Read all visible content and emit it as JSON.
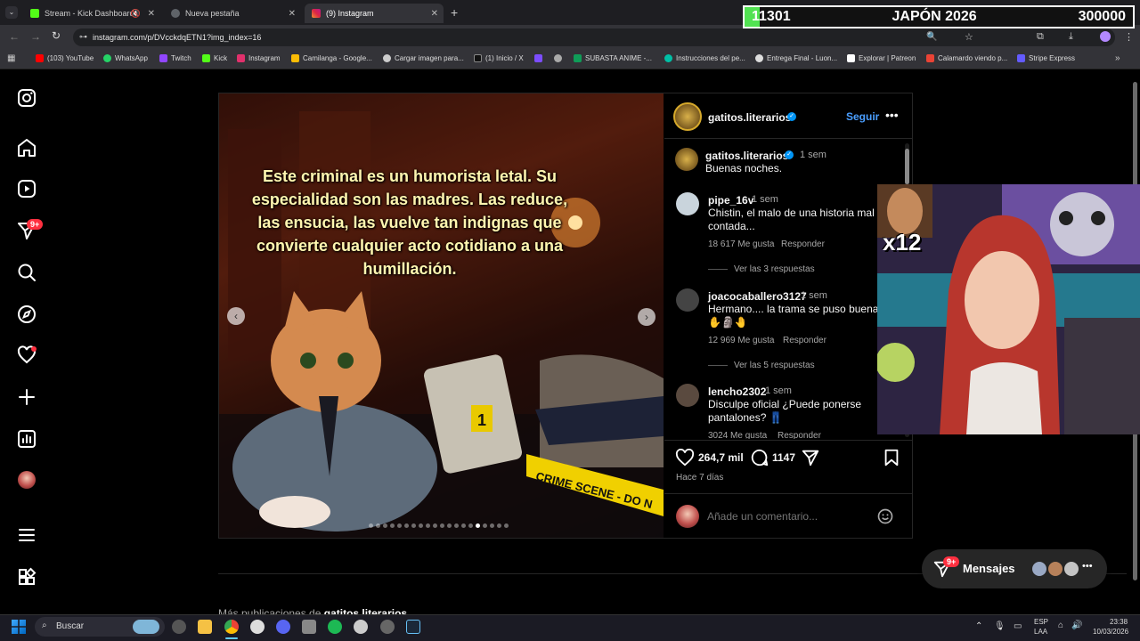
{
  "browser": {
    "tabs": [
      {
        "label": "Stream - Kick Dashboard",
        "color": "#53fc18"
      },
      {
        "label": "Nueva pestaña",
        "color": "#5f6368"
      },
      {
        "label": "(9) Instagram",
        "color": "#e1306c"
      }
    ],
    "url": "instagram.com/p/DVcckdqETN1?img_index=16",
    "bookmarks": [
      {
        "label": "(103) YouTube",
        "color": "#ff0000"
      },
      {
        "label": "WhatsApp",
        "color": "#25d366"
      },
      {
        "label": "Twitch",
        "color": "#9146ff"
      },
      {
        "label": "Kick",
        "color": "#53fc18"
      },
      {
        "label": "Instagram",
        "color": "#e1306c"
      },
      {
        "label": "Camilanga - Google...",
        "color": "#fbbc05"
      },
      {
        "label": "Cargar imagen para...",
        "color": "#cccccc"
      },
      {
        "label": "(1) Inicio / X",
        "color": "#111111"
      },
      {
        "label": "SUBASTA ANIME -...",
        "color": "#0f9d58"
      },
      {
        "label": "Instrucciones del pe...",
        "color": "#00bfa5"
      },
      {
        "label": "Entrega Final - Luon...",
        "color": "#dddddd"
      },
      {
        "label": "Explorar | Patreon",
        "color": "#ffffff"
      },
      {
        "label": "Calamardo viendo p...",
        "color": "#ea4335"
      },
      {
        "label": "Stripe Express",
        "color": "#635bff"
      }
    ]
  },
  "stream_goal": {
    "current": "11301",
    "title": "JAPÓN 2026",
    "target": "300000",
    "progress_fraction": 0.038
  },
  "sidebar": {
    "notification_badge": "9+"
  },
  "post": {
    "caption_text": "Este criminal es un humorista letal. Su especialidad son las madres. Las reduce, las ensucia, las vuelve tan indignas que convierte cualquier acto cotidiano a una humillación.",
    "scene_labels": {
      "evidence_marker": "1",
      "tape": "CRIME SCENE - DO N"
    },
    "header": {
      "username": "gatitos.literarios",
      "follow_label": "Seguir"
    },
    "author_comment": {
      "username": "gatitos.literarios",
      "time": "1 sem",
      "text": "Buenas noches."
    },
    "comments": [
      {
        "username": "pipe_16v",
        "time": "1 sem",
        "text": "Chistin, el malo de una historia mal contada...",
        "likes": "18 617 Me gusta",
        "reply": "Responder",
        "replies": "Ver las 3 respuestas"
      },
      {
        "username": "joacocaballero3127",
        "time": "1 sem",
        "text": "Hermano.... la trama se puso buena",
        "emojis": "✋🗿🤚",
        "likes": "12 969 Me gusta",
        "reply": "Responder",
        "replies": "Ver las 5 respuestas"
      },
      {
        "username": "lencho2302",
        "time": "1 sem",
        "text": "Disculpe oficial ¿Puede ponerse pantalones? 👖",
        "likes": "3024 Me gusta",
        "reply": "Responder"
      }
    ],
    "likes_count": "264,7 mil",
    "comments_count": "1147",
    "posted_ago": "Hace 7 días",
    "comment_placeholder": "Añade un comentario...",
    "carousel_index": 16,
    "carousel_total": 20
  },
  "more_posts_label": "Más publicaciones de",
  "more_posts_user": "gatitos.literarios",
  "messages": {
    "label": "Mensajes",
    "badge": "9+"
  },
  "webcam_overlay": {
    "multiplier": "x12"
  },
  "taskbar": {
    "search_placeholder": "Buscar",
    "lang": "ESP",
    "lang_sub": "LAA",
    "time": "23:38",
    "date": "10/03/2026"
  }
}
